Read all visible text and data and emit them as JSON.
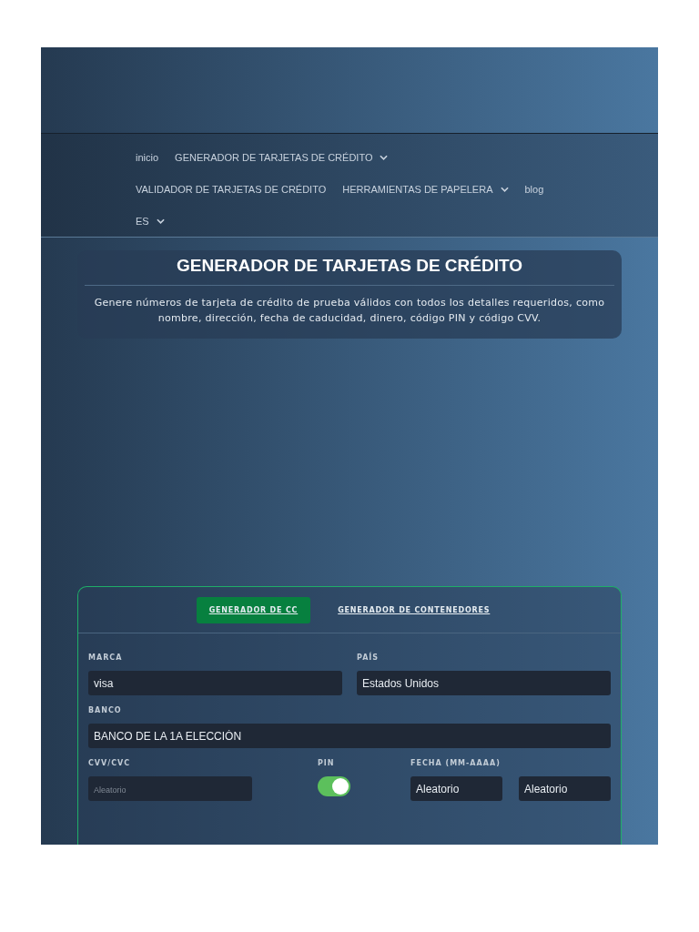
{
  "nav": {
    "rows": [
      [
        {
          "label": "inicio",
          "dropdown": false
        },
        {
          "label": "GENERADOR DE TARJETAS DE CRÉDITO",
          "dropdown": true
        }
      ],
      [
        {
          "label": "VALIDADOR DE TARJETAS DE CRÉDITO",
          "dropdown": false
        },
        {
          "label": "HERRAMIENTAS DE PAPELERA",
          "dropdown": true
        },
        {
          "label": "blog",
          "dropdown": false
        }
      ],
      [
        {
          "label": "ES",
          "dropdown": true
        }
      ]
    ]
  },
  "hero": {
    "title": "GENERADOR DE TARJETAS DE CRÉDITO",
    "description": "Genere números de tarjeta de crédito de prueba válidos con todos los detalles requeridos, como nombre, dirección, fecha de caducidad, dinero, código PIN y código CVV."
  },
  "form": {
    "tabs": [
      {
        "label": "GENERADOR DE CC",
        "selected": true
      },
      {
        "label": "GENERADOR DE CONTENEDORES",
        "selected": false
      }
    ],
    "brand": {
      "label": "MARCA",
      "value": "visa"
    },
    "country": {
      "label": "PAÍS",
      "value": "Estados Unidos"
    },
    "bank": {
      "label": "BANCO",
      "value": "BANCO DE LA 1A ELECCIÓN"
    },
    "cvv": {
      "label": "CVV/CVC",
      "placeholder": "Aleatorio"
    },
    "pin": {
      "label": "PIN",
      "on": true
    },
    "date": {
      "label": "FECHA (MM-AAAA)",
      "month": "Aleatorio",
      "year": "Aleatorio"
    }
  }
}
